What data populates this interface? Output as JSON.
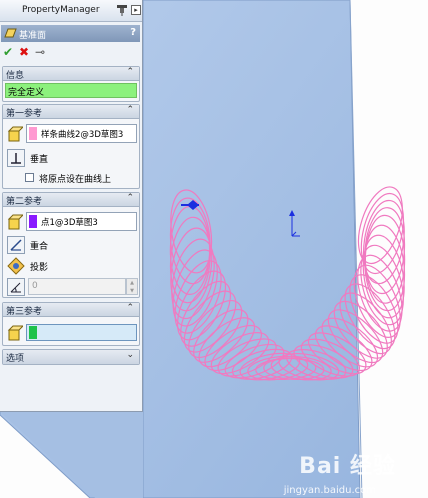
{
  "panel": {
    "title": "PropertyManager",
    "feature_name": "基准面",
    "help_glyph": "?",
    "ok_glyph": "✔",
    "cancel_glyph": "✖",
    "pushpin_glyph": "⊸"
  },
  "info": {
    "header": "信息",
    "status": "完全定义"
  },
  "first_ref": {
    "header": "第一参考",
    "selection": "样条曲线2@3D草图3",
    "swatch_color": "#ff9ad1",
    "option_label": "垂直",
    "checkbox_label": "将原点设在曲线上",
    "checkbox_checked": false
  },
  "second_ref": {
    "header": "第二参考",
    "selection": "点1@3D草图3",
    "swatch_color": "#8a1aff",
    "options": [
      "重合",
      "投影"
    ],
    "angle_value": "0"
  },
  "third_ref": {
    "header": "第三参考",
    "selection": "",
    "swatch_color": "#1ec24b"
  },
  "options_section": {
    "header": "选项"
  },
  "watermark": {
    "brand": "Bai  经验",
    "url": "jingyan.baidu.com"
  },
  "colors": {
    "plane_fill": "#a9c4e6",
    "spring_stroke": "#f07ac0",
    "status_ok": "#8cf17d",
    "origin_blue": "#1b2fe0"
  }
}
